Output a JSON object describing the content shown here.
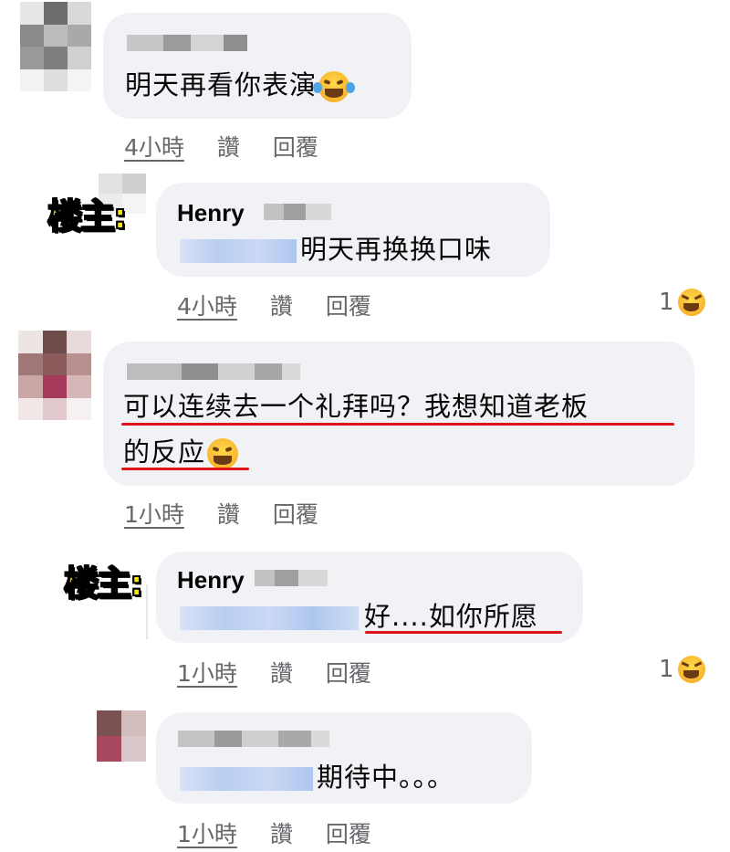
{
  "comments": [
    {
      "message": "明天再看你表演",
      "emoji": "laughing-tears-emoji",
      "time": "4小時",
      "like_label": "讚",
      "reply_label": "回覆"
    },
    {
      "badge": "楼主:",
      "author": "Henry",
      "message": "明天再换换口味",
      "time": "4小時",
      "like_label": "讚",
      "reply_label": "回覆",
      "reaction_count": "1",
      "reaction_icon": "haha-reaction-icon"
    },
    {
      "message_line1": "可以连续去一个礼拜吗？我想知道老板",
      "message_line2": "的反应",
      "emoji": "grinning-emoji",
      "time": "1小時",
      "like_label": "讚",
      "reply_label": "回覆"
    },
    {
      "badge": "楼主:",
      "author": "Henry",
      "message": "好....如你所愿",
      "time": "1小時",
      "like_label": "讚",
      "reply_label": "回覆",
      "reaction_count": "1",
      "reaction_icon": "haha-reaction-icon"
    },
    {
      "message": "期待中。。。",
      "time": "1小時",
      "like_label": "讚",
      "reply_label": "回覆"
    }
  ],
  "colors": {
    "bubble": "#f0f2f5",
    "meta_text": "#65676b",
    "highlight_underline": "#e0151b",
    "owner_badge": "#ffe600",
    "mention_blur": "#b8cdf0"
  }
}
